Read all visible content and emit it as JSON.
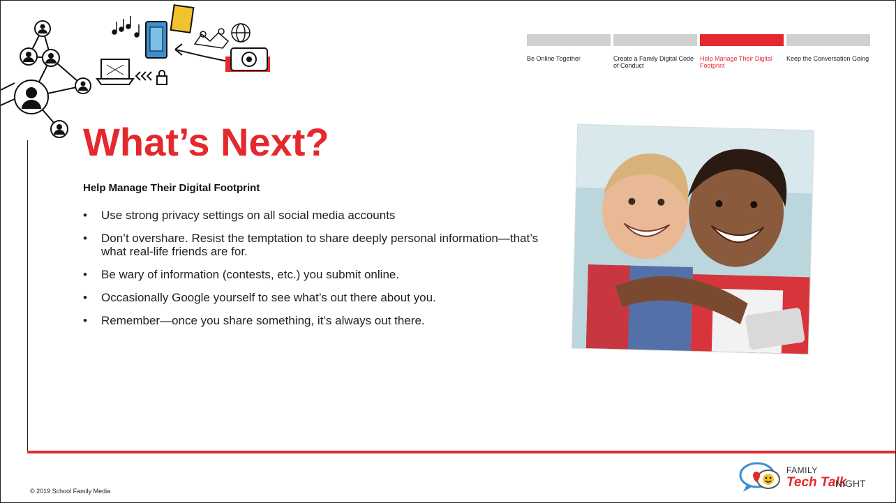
{
  "nav": {
    "steps": [
      {
        "label": "Be Online Together",
        "active": false
      },
      {
        "label": "Create a Family Digital Code of Conduct",
        "active": false
      },
      {
        "label": "Help Manage Their Digital Footprint",
        "active": true
      },
      {
        "label": "Keep the Conversation Going",
        "active": false
      }
    ]
  },
  "title": "What’s Next?",
  "subtitle": "Help Manage Their Digital Footprint",
  "bullets": [
    "Use strong privacy settings on all social media accounts",
    "Don’t overshare. Resist the temptation to share deeply personal information—that’s what real-life friends are for.",
    "Be wary of information (contests, etc.) you submit online.",
    "Occasionally Google yourself to see what’s out there about you.",
    "Remember—once you share something, it’s always out there."
  ],
  "bullet_char": "•",
  "copyright": "© 2019 School Family Media",
  "logo": {
    "family": "FAMILY",
    "tech_talk": "Tech Talk",
    "night": "NIGHT"
  },
  "colors": {
    "accent": "#e5282e",
    "inactive_bar": "#d0d0d0"
  },
  "icons": [
    "user-network-icon",
    "music-notes-icon",
    "tablet-icon",
    "map-pins-icon",
    "globe-icon",
    "laptop-icon",
    "camera-icon",
    "lock-icon",
    "speech-bubbles-icon"
  ]
}
